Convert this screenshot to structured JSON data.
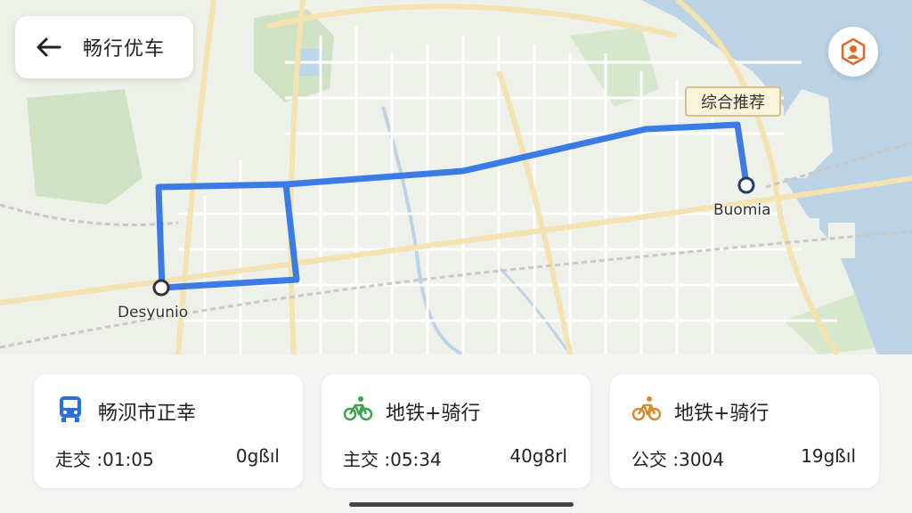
{
  "header": {
    "title": "畅行优车",
    "back_icon": "arrow-left-icon"
  },
  "map": {
    "recommend_badge": "综合推荐",
    "origin_label": "Desyunio",
    "destination_label": "Buomia",
    "route_color": "#3a7be6"
  },
  "locate_button": {
    "icon": "location-person-icon"
  },
  "options": [
    {
      "icon": "bus-icon",
      "name": "畅𬇙市正幸",
      "fare": "走交 :01:05",
      "distance": "0gßıl",
      "icon_color": "#2a6fdb"
    },
    {
      "icon": "bicycle-icon",
      "name": "地铁+骑行",
      "fare": "主交 :05:34",
      "distance": "40g8rl",
      "icon_color": "#3aa54a"
    },
    {
      "icon": "bicycle-icon",
      "name": "地铁+骑行",
      "fare": "公交 :3004",
      "distance": "19gßıl",
      "icon_color": "#d98a2b"
    }
  ]
}
